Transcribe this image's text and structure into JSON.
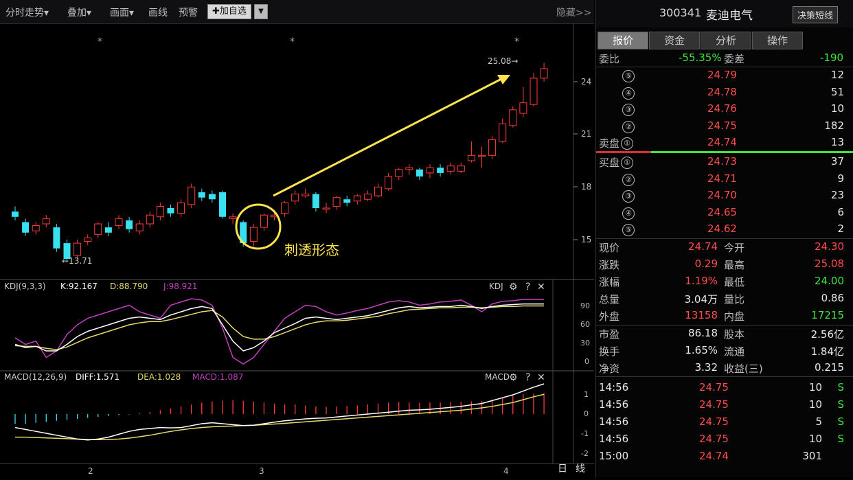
{
  "toolbar": {
    "items": [
      "分时走势▾",
      "叠加▾",
      "画面▾",
      "画线",
      "预警"
    ],
    "add_watch": "✚加自选",
    "collapse": "隐藏>>"
  },
  "kline": {
    "star_marker": "*",
    "high_label": "25.08→",
    "low_label": "←13.71",
    "annotation": "刺透形态",
    "y_ticks": [
      "24",
      "21",
      "18",
      "15"
    ],
    "x_ticks": [
      "2",
      "3",
      "4"
    ],
    "period_tabs": [
      "日",
      "线"
    ]
  },
  "kdj": {
    "title": "KDJ(9,3,3)",
    "k": "K:92.167",
    "d": "D:88.790",
    "j": "J:98.921",
    "label": "KDJ",
    "y_ticks": [
      "90",
      "60",
      "30",
      "0"
    ]
  },
  "macd": {
    "title": "MACD(12,26,9)",
    "diff": "DIFF:1.571",
    "dea": "DEA:1.028",
    "macd": "MACD:1.087",
    "label": "MACD",
    "y_ticks": [
      "1",
      "0",
      "-1",
      "-2"
    ]
  },
  "quote": {
    "code": "300341",
    "name": "麦迪电气",
    "decide_btn": "决策短线",
    "tabs": [
      "报价",
      "资金",
      "分析",
      "操作"
    ],
    "weibi_label": "委比",
    "weibi": "-55.35%",
    "weicha_label": "委差",
    "weicha": "-190",
    "asks": [
      {
        "n": "⑤",
        "price": "24.79",
        "vol": "12"
      },
      {
        "n": "④",
        "price": "24.78",
        "vol": "51"
      },
      {
        "n": "③",
        "price": "24.76",
        "vol": "10"
      },
      {
        "n": "②",
        "price": "24.75",
        "vol": "182"
      },
      {
        "n": "①",
        "price": "24.74",
        "vol": "13"
      }
    ],
    "ask_label": "卖盘",
    "bid_label": "买盘",
    "bids": [
      {
        "n": "①",
        "price": "24.73",
        "vol": "37"
      },
      {
        "n": "②",
        "price": "24.71",
        "vol": "9"
      },
      {
        "n": "③",
        "price": "24.70",
        "vol": "23"
      },
      {
        "n": "④",
        "price": "24.65",
        "vol": "6"
      },
      {
        "n": "⑤",
        "price": "24.62",
        "vol": "2"
      }
    ],
    "stats": [
      {
        "l1": "现价",
        "v1": "24.74",
        "c1": "red",
        "l2": "今开",
        "v2": "24.30",
        "c2": "red"
      },
      {
        "l1": "涨跌",
        "v1": "0.29",
        "c1": "red",
        "l2": "最高",
        "v2": "25.08",
        "c2": "red"
      },
      {
        "l1": "涨幅",
        "v1": "1.19%",
        "c1": "red",
        "l2": "最低",
        "v2": "24.00",
        "c2": "green"
      },
      {
        "l1": "总量",
        "v1": "3.04万",
        "c1": "white",
        "l2": "量比",
        "v2": "0.86",
        "c2": "white"
      },
      {
        "l1": "外盘",
        "v1": "13158",
        "c1": "red",
        "l2": "内盘",
        "v2": "17215",
        "c2": "green"
      }
    ],
    "stats2": [
      {
        "l1": "市盈",
        "v1": "86.18",
        "l2": "股本",
        "v2": "2.56亿"
      },
      {
        "l1": "换手",
        "v1": "1.65%",
        "l2": "流通",
        "v2": "1.84亿"
      },
      {
        "l1": "净资",
        "v1": "3.32",
        "l2": "收益(三)",
        "v2": "0.215"
      }
    ],
    "ticks": [
      {
        "t": "14:56",
        "p": "24.75",
        "v": "10",
        "s": "S"
      },
      {
        "t": "14:56",
        "p": "24.75",
        "v": "10",
        "s": "S"
      },
      {
        "t": "14:56",
        "p": "24.75",
        "v": "5",
        "s": "S"
      },
      {
        "t": "14:56",
        "p": "24.75",
        "v": "10",
        "s": "S"
      },
      {
        "t": "15:00",
        "p": "24.74",
        "v": "301",
        "s": ""
      }
    ]
  },
  "colors": {
    "up": "#ff3b3b",
    "down": "#39e0ef",
    "k_line": "#ffffff",
    "d_line": "#e6d96a",
    "j_line": "#c040c0",
    "arrow": "#ffe34d"
  }
}
